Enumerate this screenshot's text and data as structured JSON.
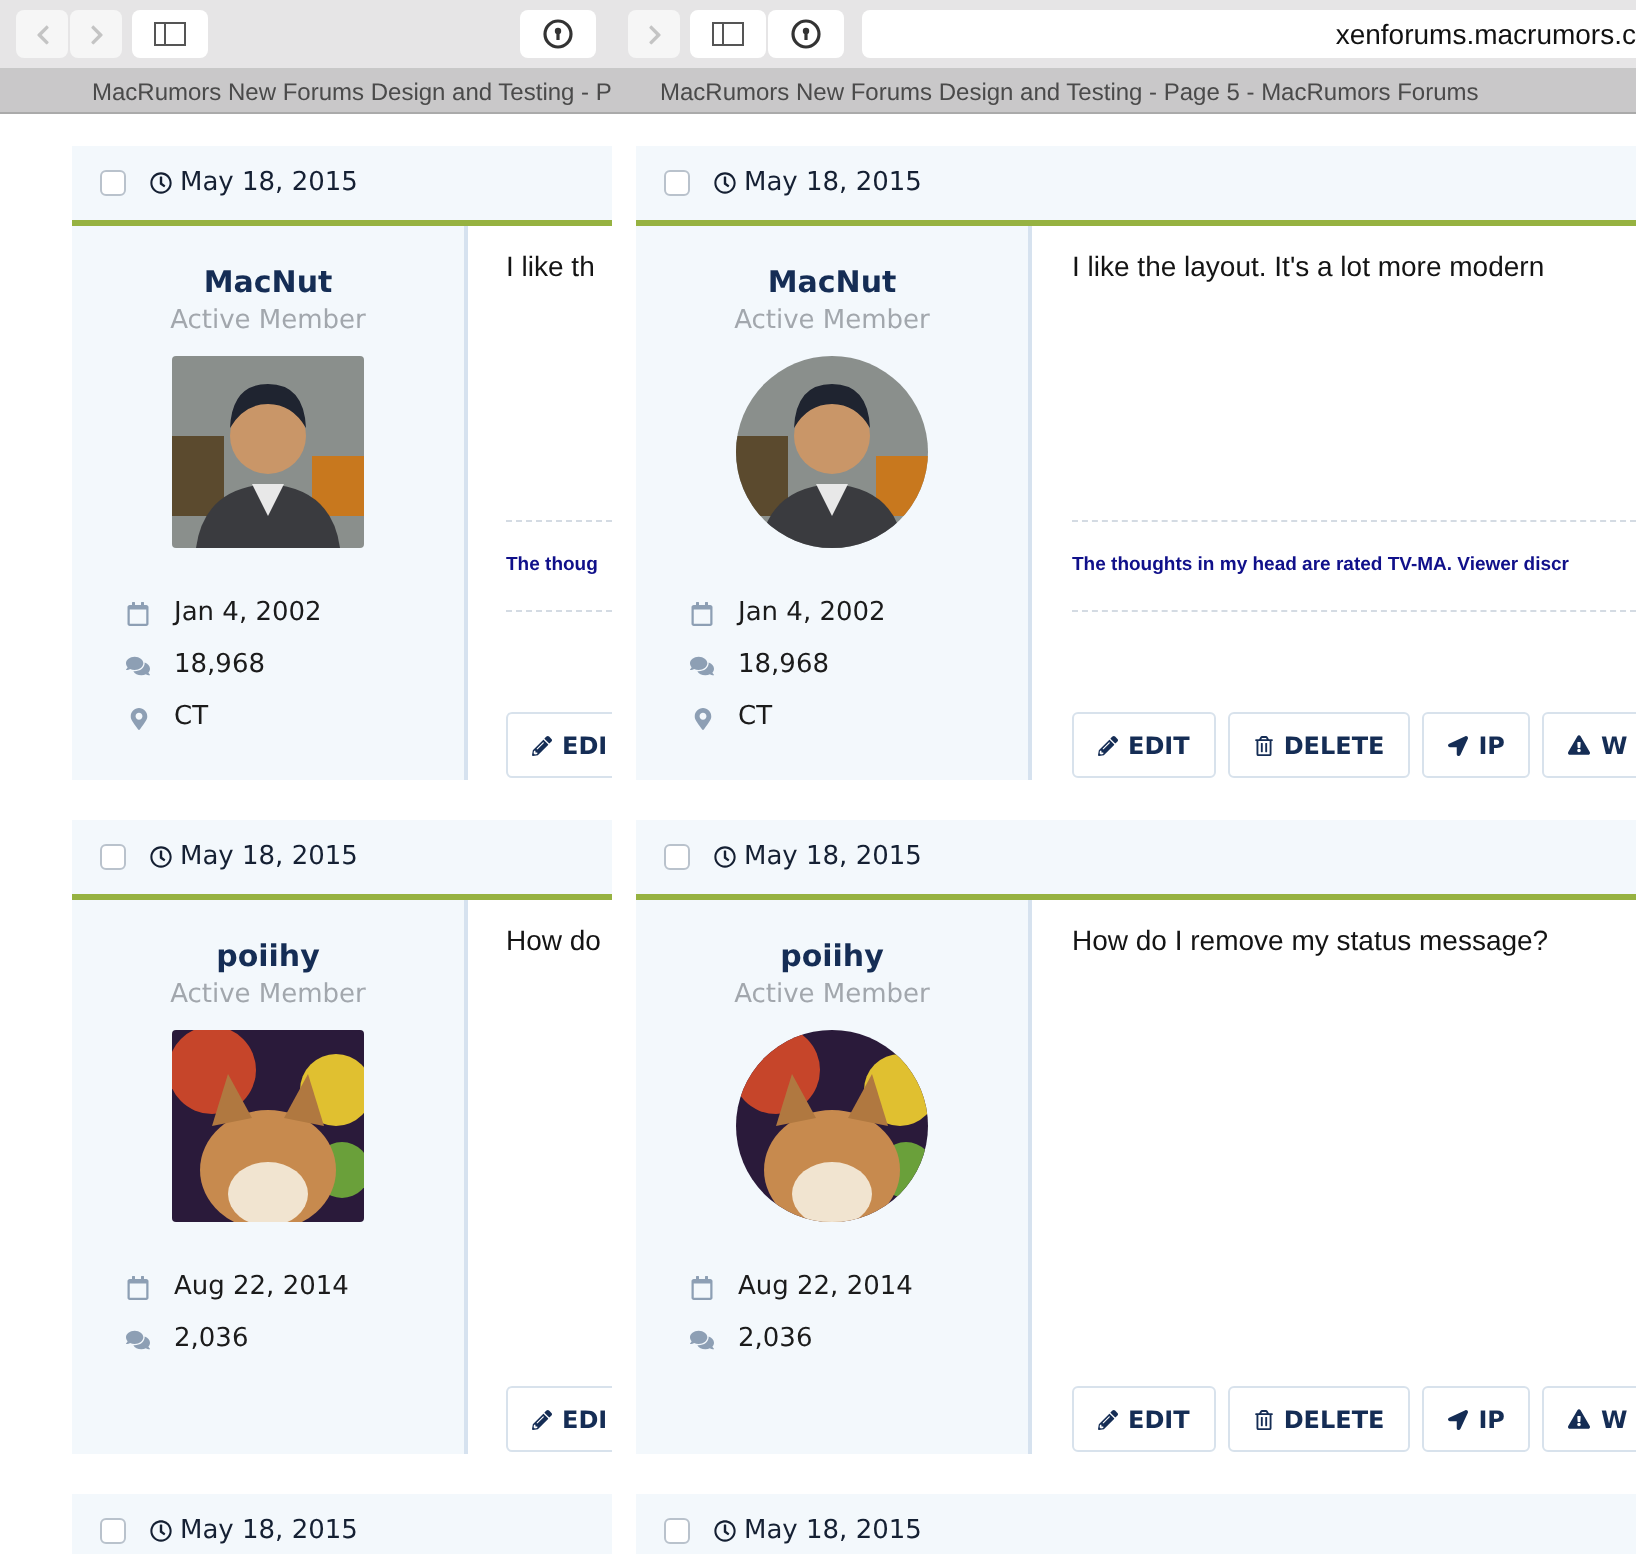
{
  "windows": [
    {
      "toolbar": [
        {
          "kind": "back",
          "disabled": true
        },
        {
          "kind": "forward",
          "disabled": true
        },
        {
          "kind": "sidebar"
        },
        {
          "kind": "password"
        }
      ],
      "tab_title": "MacRumors New Forums Design and Testing - P",
      "posts": [
        {
          "checked": false,
          "date": "May 18, 2015",
          "author": "MacNut",
          "role": "Active Member",
          "avatar": {
            "kind": "illustration",
            "rounded": false
          },
          "stats": [
            {
              "kind": "joined",
              "text": "Jan 4, 2002"
            },
            {
              "kind": "messages",
              "text": "18,968"
            },
            {
              "kind": "location",
              "text": "CT"
            }
          ],
          "message": "I like th",
          "signature": "The thoug",
          "buttons": [
            {
              "kind": "edit",
              "label": "EDI"
            }
          ]
        },
        {
          "checked": false,
          "date": "May 18, 2015",
          "author": "poiihy",
          "role": "Active Member",
          "avatar": {
            "kind": "picture",
            "rounded": false
          },
          "stats": [
            {
              "kind": "joined",
              "text": "Aug 22, 2014"
            },
            {
              "kind": "messages",
              "text": "2,036"
            }
          ],
          "message": "How do",
          "buttons": [
            {
              "kind": "edit",
              "label": "EDI"
            }
          ]
        },
        {
          "checked": false,
          "date": "May 18, 2015"
        }
      ]
    },
    {
      "toolbar": [
        {
          "kind": "forward",
          "disabled": true
        },
        {
          "kind": "sidebar"
        },
        {
          "kind": "password"
        }
      ],
      "address": "xenforums.macrumors.c",
      "tab_title": "MacRumors New Forums Design and Testing - Page 5 - MacRumors Forums",
      "posts": [
        {
          "checked": false,
          "date": "May 18, 2015",
          "author": "MacNut",
          "role": "Active Member",
          "avatar": {
            "kind": "illustration",
            "rounded": true
          },
          "stats": [
            {
              "kind": "joined",
              "text": "Jan 4, 2002"
            },
            {
              "kind": "messages",
              "text": "18,968"
            },
            {
              "kind": "location",
              "text": "CT"
            }
          ],
          "message": "I like the layout. It's a lot more modern",
          "signature": "The thoughts in my head are rated TV-MA. Viewer discr",
          "buttons": [
            {
              "kind": "edit",
              "label": "EDIT"
            },
            {
              "kind": "delete",
              "label": "DELETE"
            },
            {
              "kind": "ip",
              "label": "IP"
            },
            {
              "kind": "warn",
              "label": "W"
            }
          ]
        },
        {
          "checked": false,
          "date": "May 18, 2015",
          "author": "poiihy",
          "role": "Active Member",
          "avatar": {
            "kind": "picture",
            "rounded": true
          },
          "stats": [
            {
              "kind": "joined",
              "text": "Aug 22, 2014"
            },
            {
              "kind": "messages",
              "text": "2,036"
            }
          ],
          "message": "How do I remove my status message?",
          "buttons": [
            {
              "kind": "edit",
              "label": "EDIT"
            },
            {
              "kind": "delete",
              "label": "DELETE"
            },
            {
              "kind": "ip",
              "label": "IP"
            },
            {
              "kind": "warn",
              "label": "W"
            }
          ]
        },
        {
          "checked": false,
          "date": "May 18, 2015"
        }
      ]
    }
  ]
}
